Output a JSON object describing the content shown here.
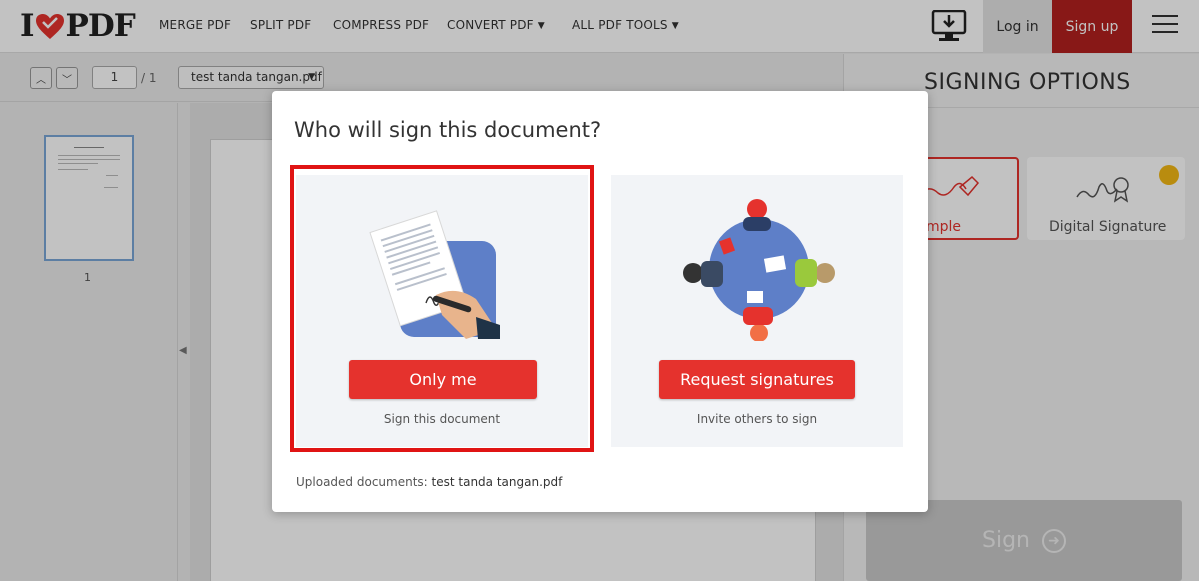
{
  "header": {
    "logo": {
      "left": "I",
      "right": "PDF"
    },
    "nav": [
      {
        "label": "MERGE PDF",
        "dropdown": false
      },
      {
        "label": "SPLIT PDF",
        "dropdown": false
      },
      {
        "label": "COMPRESS PDF",
        "dropdown": false
      },
      {
        "label": "CONVERT PDF",
        "dropdown": true
      },
      {
        "label": "ALL PDF TOOLS",
        "dropdown": true
      }
    ],
    "login_label": "Log in",
    "signup_label": "Sign up"
  },
  "toolbar": {
    "page_current": "1",
    "page_total": "/ 1",
    "file_name": "test tanda tangan.pdf"
  },
  "thumbnails": {
    "page_number": "1"
  },
  "signing_options": {
    "title": "SIGNING OPTIONS",
    "simple_label": "mple",
    "digital_label": "Digital Signature",
    "sign_label": "Sign"
  },
  "modal": {
    "title": "Who will sign this document?",
    "only_me": {
      "button": "Only me",
      "subtitle": "Sign this document"
    },
    "request": {
      "button": "Request signatures",
      "subtitle": "Invite others to sign"
    },
    "uploaded_label": "Uploaded documents:",
    "uploaded_file": "test tanda tangan.pdf"
  },
  "colors": {
    "brand_red": "#e5322d",
    "highlight_red": "#e01414",
    "signup_red": "#b3201f"
  }
}
